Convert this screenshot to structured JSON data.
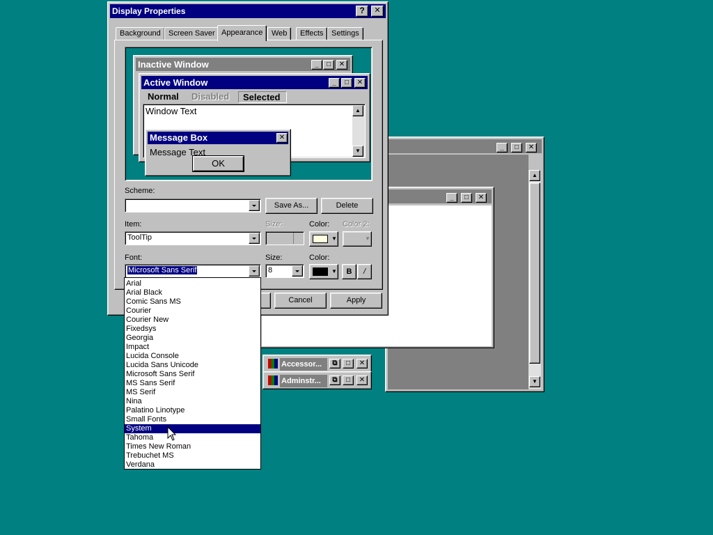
{
  "dialog": {
    "title": "Display Properties",
    "help_label": "?",
    "close_label": "✕",
    "tabs": [
      {
        "label": "Background"
      },
      {
        "label": "Screen Saver"
      },
      {
        "label": "Appearance"
      },
      {
        "label": "Web"
      },
      {
        "label": "Effects"
      },
      {
        "label": "Settings"
      }
    ],
    "active_tab": "Appearance"
  },
  "preview": {
    "inactive_window_title": "Inactive Window",
    "active_window_title": "Active Window",
    "menu_normal": "Normal",
    "menu_disabled": "Disabled",
    "menu_selected": "Selected",
    "window_text": "Window Text",
    "message_box_title": "Message Box",
    "message_text": "Message Text",
    "ok_label": "OK"
  },
  "form": {
    "scheme_label": "Scheme:",
    "scheme_value": "",
    "save_as_label": "Save As...",
    "delete_label": "Delete",
    "item_label": "Item:",
    "item_value": "ToolTip",
    "item_size_label": "Size:",
    "item_color_label": "Color:",
    "item_color2_label": "Color 2:",
    "font_label": "Font:",
    "font_value": "Microsoft Sans Serif",
    "font_size_label": "Size:",
    "font_size_value": "8",
    "font_color_label": "Color:",
    "bold_label": "B",
    "italic_label": "/",
    "cancel_label": "Cancel",
    "apply_label": "Apply"
  },
  "font_list": {
    "items": [
      "Arial",
      "Arial Black",
      "Comic Sans MS",
      "Courier",
      "Courier New",
      "Fixedsys",
      "Georgia",
      "Impact",
      "Lucida Console",
      "Lucida Sans Unicode",
      "Microsoft Sans Serif",
      "MS Sans Serif",
      "MS Serif",
      "Nina",
      "Palatino Linotype",
      "Small Fonts",
      "System",
      "Tahoma",
      "Times New Roman",
      "Trebuchet MS",
      "Verdana"
    ],
    "selected": "System"
  },
  "taskbar_windows": [
    {
      "title": "Accessor..."
    },
    {
      "title": "Adminstr..."
    }
  ],
  "colors": {
    "desktop": "#008080",
    "title_active": "#000080",
    "title_inactive": "#808080",
    "face": "#c0c0c0",
    "tooltip_color": "#ffffe1",
    "font_color": "#000000"
  }
}
